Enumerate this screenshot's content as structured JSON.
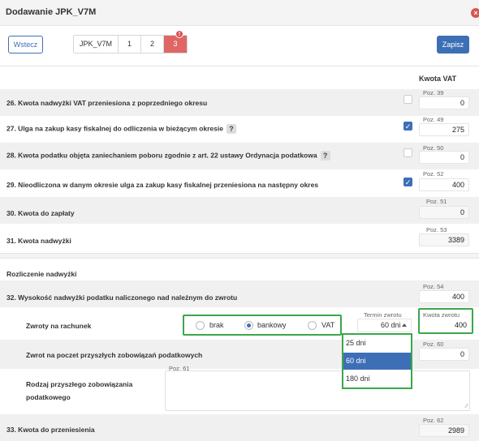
{
  "window": {
    "title": "Dodawanie JPK_V7M",
    "close_glyph": "×"
  },
  "toolbar": {
    "back_label": "Wstecz",
    "tabs": [
      "JPK_V7M",
      "1",
      "2",
      "3"
    ],
    "active_tab_badge": "!",
    "save_label": "Zapisz"
  },
  "column_header": "Kwota VAT",
  "rows": [
    {
      "label": "26. Kwota nadwyżki VAT przeniesiona z poprzedniego okresu",
      "poz": "Poz. 39",
      "value": "0",
      "checkbox": false,
      "help": false
    },
    {
      "label": "27. Ulga na zakup kasy fiskalnej do odliczenia w bieżącym okresie",
      "poz": "Poz. 49",
      "value": "275",
      "checkbox": true,
      "help": true
    },
    {
      "label": "28. Kwota podatku objęta zaniechaniem poboru zgodnie z art. 22 ustawy Ordynacja podatkowa",
      "poz": "Poz. 50",
      "value": "0",
      "checkbox": false,
      "help": true
    },
    {
      "label": "29. Nieodliczona w danym okresie ulga za zakup kasy fiskalnej przeniesiona na następny okres",
      "poz": "Poz. 52",
      "value": "400",
      "checkbox": true,
      "help": false
    },
    {
      "label": "30. Kwota do zapłaty",
      "poz": "Poz. 51",
      "value": "0"
    },
    {
      "label": "31. Kwota nadwyżki",
      "poz": "Poz. 53",
      "value": "3389"
    }
  ],
  "help_glyph": "?",
  "check_glyph": "✓",
  "settlement": {
    "section_title": "Rozliczenie nadwyżki",
    "row32": {
      "label": "32. Wysokość nadwyżki podatku naliczonego nad należnym do zwrotu",
      "poz": "Poz. 54",
      "value": "400"
    },
    "refunds": {
      "label": "Zwroty na rachunek",
      "options": [
        "brak",
        "bankowy",
        "VAT"
      ],
      "selected": "bankowy",
      "term_label": "Termin zwrotu",
      "term_value": "60 dni",
      "term_options": [
        "25 dni",
        "60 dni",
        "180 dni"
      ],
      "amount_label": "Kwota zwrotu",
      "amount_value": "400"
    },
    "future_refund": {
      "label": "Zwrot na poczet przyszłych zobowiązań podatkowych",
      "poz": "Poz. 60",
      "value": "0"
    },
    "liability_type": {
      "label_line1": "Rodzaj przyszłego zobowiązania",
      "label_line2": "podatkowego",
      "poz": "Poz. 61",
      "value": ""
    },
    "row33": {
      "label": "33. Kwota do przeniesienia",
      "poz": "Poz. 62",
      "value": "2989"
    }
  },
  "colors": {
    "accent": "#3d6fb6",
    "danger": "#d9534f",
    "highlight": "#3aa74a"
  }
}
